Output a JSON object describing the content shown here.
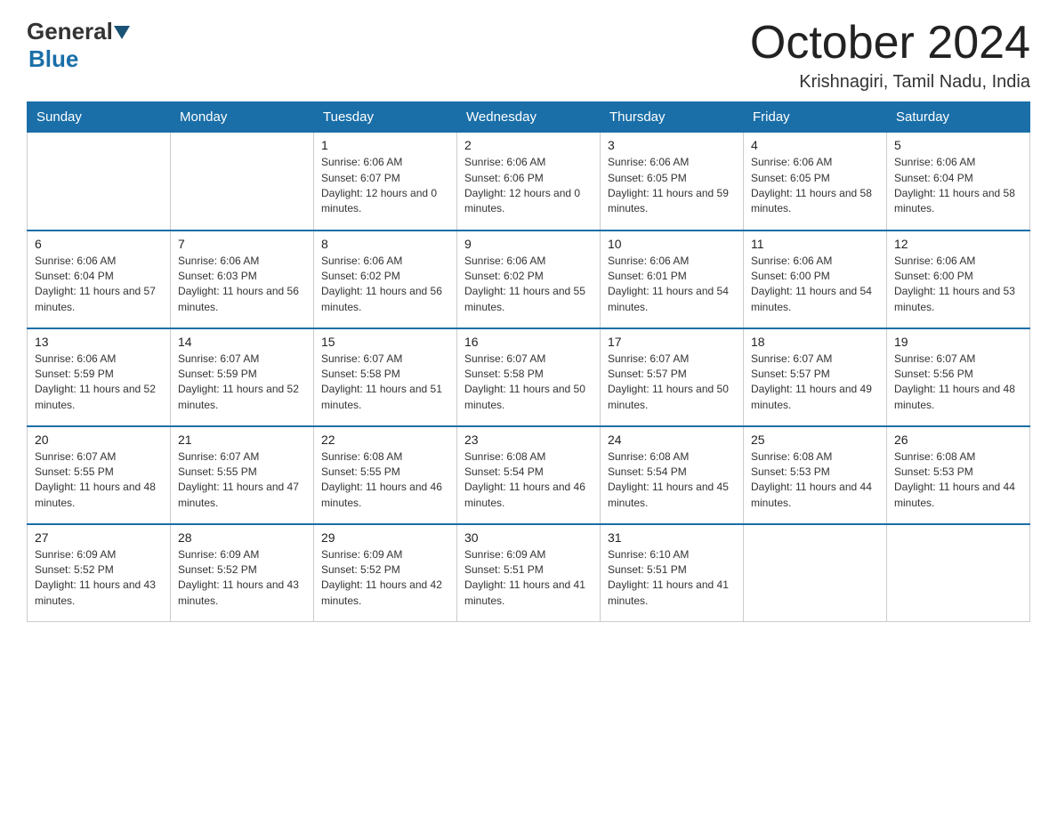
{
  "header": {
    "month_title": "October 2024",
    "location": "Krishnagiri, Tamil Nadu, India",
    "logo_general": "General",
    "logo_blue": "Blue"
  },
  "days_of_week": [
    "Sunday",
    "Monday",
    "Tuesday",
    "Wednesday",
    "Thursday",
    "Friday",
    "Saturday"
  ],
  "weeks": [
    [
      {
        "day": "",
        "sunrise": "",
        "sunset": "",
        "daylight": ""
      },
      {
        "day": "",
        "sunrise": "",
        "sunset": "",
        "daylight": ""
      },
      {
        "day": "1",
        "sunrise": "Sunrise: 6:06 AM",
        "sunset": "Sunset: 6:07 PM",
        "daylight": "Daylight: 12 hours and 0 minutes."
      },
      {
        "day": "2",
        "sunrise": "Sunrise: 6:06 AM",
        "sunset": "Sunset: 6:06 PM",
        "daylight": "Daylight: 12 hours and 0 minutes."
      },
      {
        "day": "3",
        "sunrise": "Sunrise: 6:06 AM",
        "sunset": "Sunset: 6:05 PM",
        "daylight": "Daylight: 11 hours and 59 minutes."
      },
      {
        "day": "4",
        "sunrise": "Sunrise: 6:06 AM",
        "sunset": "Sunset: 6:05 PM",
        "daylight": "Daylight: 11 hours and 58 minutes."
      },
      {
        "day": "5",
        "sunrise": "Sunrise: 6:06 AM",
        "sunset": "Sunset: 6:04 PM",
        "daylight": "Daylight: 11 hours and 58 minutes."
      }
    ],
    [
      {
        "day": "6",
        "sunrise": "Sunrise: 6:06 AM",
        "sunset": "Sunset: 6:04 PM",
        "daylight": "Daylight: 11 hours and 57 minutes."
      },
      {
        "day": "7",
        "sunrise": "Sunrise: 6:06 AM",
        "sunset": "Sunset: 6:03 PM",
        "daylight": "Daylight: 11 hours and 56 minutes."
      },
      {
        "day": "8",
        "sunrise": "Sunrise: 6:06 AM",
        "sunset": "Sunset: 6:02 PM",
        "daylight": "Daylight: 11 hours and 56 minutes."
      },
      {
        "day": "9",
        "sunrise": "Sunrise: 6:06 AM",
        "sunset": "Sunset: 6:02 PM",
        "daylight": "Daylight: 11 hours and 55 minutes."
      },
      {
        "day": "10",
        "sunrise": "Sunrise: 6:06 AM",
        "sunset": "Sunset: 6:01 PM",
        "daylight": "Daylight: 11 hours and 54 minutes."
      },
      {
        "day": "11",
        "sunrise": "Sunrise: 6:06 AM",
        "sunset": "Sunset: 6:00 PM",
        "daylight": "Daylight: 11 hours and 54 minutes."
      },
      {
        "day": "12",
        "sunrise": "Sunrise: 6:06 AM",
        "sunset": "Sunset: 6:00 PM",
        "daylight": "Daylight: 11 hours and 53 minutes."
      }
    ],
    [
      {
        "day": "13",
        "sunrise": "Sunrise: 6:06 AM",
        "sunset": "Sunset: 5:59 PM",
        "daylight": "Daylight: 11 hours and 52 minutes."
      },
      {
        "day": "14",
        "sunrise": "Sunrise: 6:07 AM",
        "sunset": "Sunset: 5:59 PM",
        "daylight": "Daylight: 11 hours and 52 minutes."
      },
      {
        "day": "15",
        "sunrise": "Sunrise: 6:07 AM",
        "sunset": "Sunset: 5:58 PM",
        "daylight": "Daylight: 11 hours and 51 minutes."
      },
      {
        "day": "16",
        "sunrise": "Sunrise: 6:07 AM",
        "sunset": "Sunset: 5:58 PM",
        "daylight": "Daylight: 11 hours and 50 minutes."
      },
      {
        "day": "17",
        "sunrise": "Sunrise: 6:07 AM",
        "sunset": "Sunset: 5:57 PM",
        "daylight": "Daylight: 11 hours and 50 minutes."
      },
      {
        "day": "18",
        "sunrise": "Sunrise: 6:07 AM",
        "sunset": "Sunset: 5:57 PM",
        "daylight": "Daylight: 11 hours and 49 minutes."
      },
      {
        "day": "19",
        "sunrise": "Sunrise: 6:07 AM",
        "sunset": "Sunset: 5:56 PM",
        "daylight": "Daylight: 11 hours and 48 minutes."
      }
    ],
    [
      {
        "day": "20",
        "sunrise": "Sunrise: 6:07 AM",
        "sunset": "Sunset: 5:55 PM",
        "daylight": "Daylight: 11 hours and 48 minutes."
      },
      {
        "day": "21",
        "sunrise": "Sunrise: 6:07 AM",
        "sunset": "Sunset: 5:55 PM",
        "daylight": "Daylight: 11 hours and 47 minutes."
      },
      {
        "day": "22",
        "sunrise": "Sunrise: 6:08 AM",
        "sunset": "Sunset: 5:55 PM",
        "daylight": "Daylight: 11 hours and 46 minutes."
      },
      {
        "day": "23",
        "sunrise": "Sunrise: 6:08 AM",
        "sunset": "Sunset: 5:54 PM",
        "daylight": "Daylight: 11 hours and 46 minutes."
      },
      {
        "day": "24",
        "sunrise": "Sunrise: 6:08 AM",
        "sunset": "Sunset: 5:54 PM",
        "daylight": "Daylight: 11 hours and 45 minutes."
      },
      {
        "day": "25",
        "sunrise": "Sunrise: 6:08 AM",
        "sunset": "Sunset: 5:53 PM",
        "daylight": "Daylight: 11 hours and 44 minutes."
      },
      {
        "day": "26",
        "sunrise": "Sunrise: 6:08 AM",
        "sunset": "Sunset: 5:53 PM",
        "daylight": "Daylight: 11 hours and 44 minutes."
      }
    ],
    [
      {
        "day": "27",
        "sunrise": "Sunrise: 6:09 AM",
        "sunset": "Sunset: 5:52 PM",
        "daylight": "Daylight: 11 hours and 43 minutes."
      },
      {
        "day": "28",
        "sunrise": "Sunrise: 6:09 AM",
        "sunset": "Sunset: 5:52 PM",
        "daylight": "Daylight: 11 hours and 43 minutes."
      },
      {
        "day": "29",
        "sunrise": "Sunrise: 6:09 AM",
        "sunset": "Sunset: 5:52 PM",
        "daylight": "Daylight: 11 hours and 42 minutes."
      },
      {
        "day": "30",
        "sunrise": "Sunrise: 6:09 AM",
        "sunset": "Sunset: 5:51 PM",
        "daylight": "Daylight: 11 hours and 41 minutes."
      },
      {
        "day": "31",
        "sunrise": "Sunrise: 6:10 AM",
        "sunset": "Sunset: 5:51 PM",
        "daylight": "Daylight: 11 hours and 41 minutes."
      },
      {
        "day": "",
        "sunrise": "",
        "sunset": "",
        "daylight": ""
      },
      {
        "day": "",
        "sunrise": "",
        "sunset": "",
        "daylight": ""
      }
    ]
  ]
}
